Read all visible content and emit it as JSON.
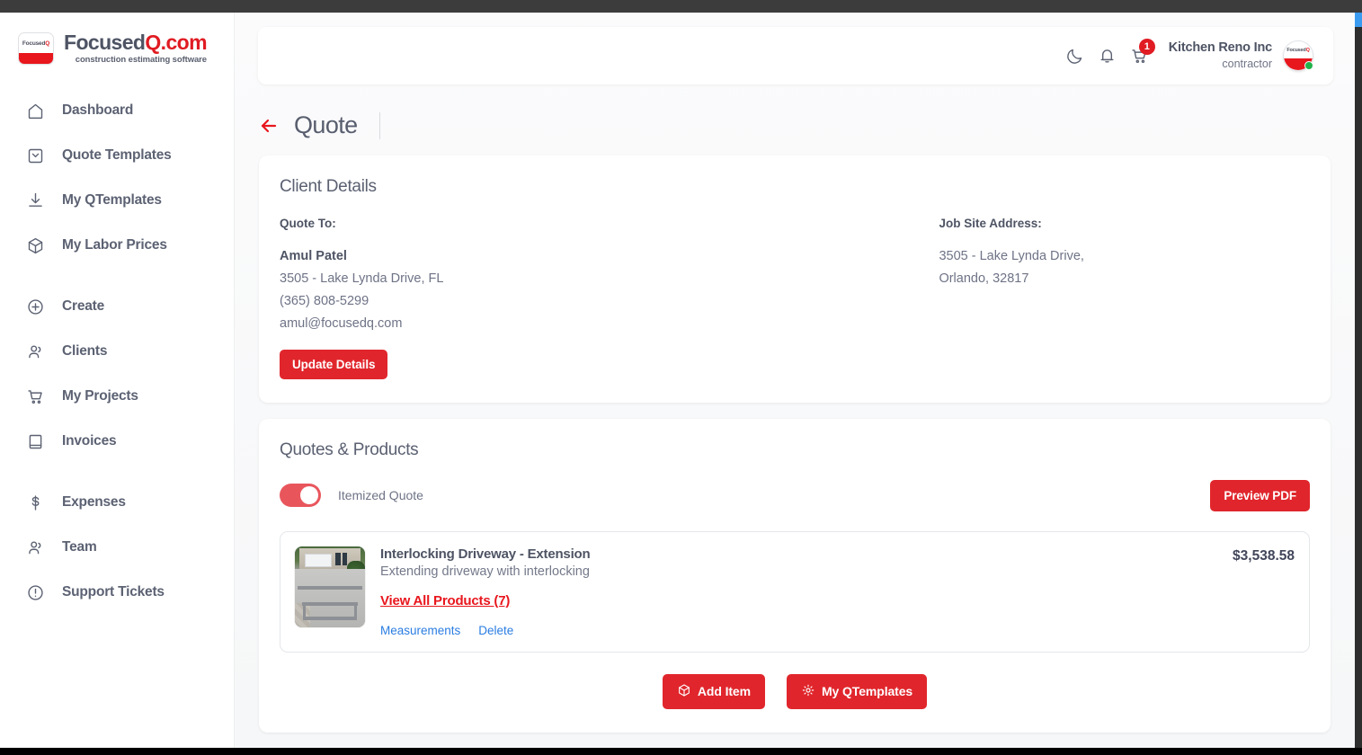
{
  "brand": {
    "logo_main_dark": "Focused",
    "logo_main_red": "Q.com",
    "logo_tagline": "construction estimating software",
    "logo_mark_dark": "Focused",
    "logo_mark_red": "Q",
    "accent_red": "#e0262c",
    "link_blue": "#2a7de1",
    "toggle_red": "#e8565c"
  },
  "sidebar": {
    "items": [
      {
        "label": "Dashboard",
        "icon": "home-icon"
      },
      {
        "label": "Quote Templates",
        "icon": "briefcase-icon"
      },
      {
        "label": "My QTemplates",
        "icon": "download-icon"
      },
      {
        "label": "My Labor Prices",
        "icon": "box-icon"
      },
      {
        "label": "Create",
        "icon": "plus-circle-icon"
      },
      {
        "label": "Clients",
        "icon": "users-icon"
      },
      {
        "label": "My Projects",
        "icon": "cart-icon"
      },
      {
        "label": "Invoices",
        "icon": "book-icon"
      },
      {
        "label": "Expenses",
        "icon": "dollar-icon"
      },
      {
        "label": "Team",
        "icon": "users-icon"
      },
      {
        "label": "Support Tickets",
        "icon": "alert-circle-icon"
      }
    ]
  },
  "topbar": {
    "dark_mode_icon": "moon-icon",
    "notifications_icon": "bell-icon",
    "cart_icon": "cart-icon",
    "cart_badge": "1",
    "company": "Kitchen Reno Inc",
    "role": "contractor",
    "avatar_text_dark": "Focused",
    "avatar_text_red": "Q",
    "status": "online"
  },
  "page": {
    "back_icon": "arrow-left-icon",
    "title": "Quote"
  },
  "client_details": {
    "title": "Client Details",
    "quote_to_label": "Quote To:",
    "name": "Amul Patel",
    "address": "3505 - Lake Lynda Drive, FL",
    "phone": "(365) 808-5299",
    "email": "amul@focusedq.com",
    "update_button": "Update Details",
    "job_site_label": "Job Site Address:",
    "job_site_line1": "3505 - Lake Lynda Drive,",
    "job_site_line2": "Orlando, 32817"
  },
  "quotes_products": {
    "title": "Quotes & Products",
    "itemized_label": "Itemized Quote",
    "itemized_on": true,
    "preview_button": "Preview PDF",
    "items": [
      {
        "title": "Interlocking Driveway - Extension",
        "description": "Extending driveway with interlocking",
        "view_all_link": "View All Products (7)",
        "measurements_link": "Measurements",
        "delete_link": "Delete",
        "price": "$3,538.58",
        "thumbnail": "driveway-photo"
      }
    ],
    "add_item_button": "Add Item",
    "add_item_icon": "box-icon",
    "my_qtemplates_button": "My QTemplates",
    "my_qtemplates_icon": "gear-icon"
  }
}
